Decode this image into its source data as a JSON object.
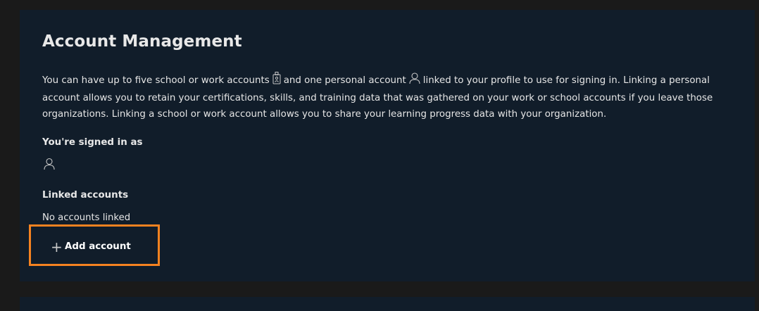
{
  "account_management": {
    "title": "Account Management",
    "description_part1": "You can have up to five school or work accounts",
    "description_part2": "and one personal account",
    "description_part3": "linked to your profile to use for signing in. Linking a personal account allows you to retain your certifications, skills, and training data that was gathered on your work or school accounts if you leave those organizations. Linking a school or work account allows you to share your learning progress data with your organization.",
    "work_account_icon": "badge-icon",
    "personal_account_icon": "person-icon",
    "signed_in_label": "You're signed in as",
    "signed_in_icon": "person-icon",
    "linked_accounts_label": "Linked accounts",
    "linked_accounts_status": "No accounts linked",
    "add_account_label": "Add account",
    "add_account_icon": "plus-icon",
    "highlight_color": "#f58220"
  }
}
